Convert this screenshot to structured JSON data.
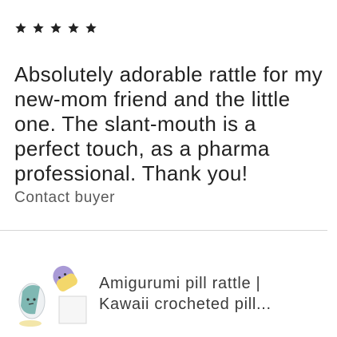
{
  "review": {
    "rating": 5,
    "rating_max": 5,
    "text": "Absolutely adorable rattle for my new-mom friend and the little one. The slant-mouth is a perfect touch, as a pharma professional. Thank you!",
    "contact_label": "Contact buyer"
  },
  "product": {
    "title_line1": "Amigurumi pill rattle |",
    "title_line2": "Kawaii crocheted pill..."
  },
  "colors": {
    "star": "#222222",
    "text": "#222222",
    "muted": "#595959",
    "divider": "#d6d6d6"
  }
}
